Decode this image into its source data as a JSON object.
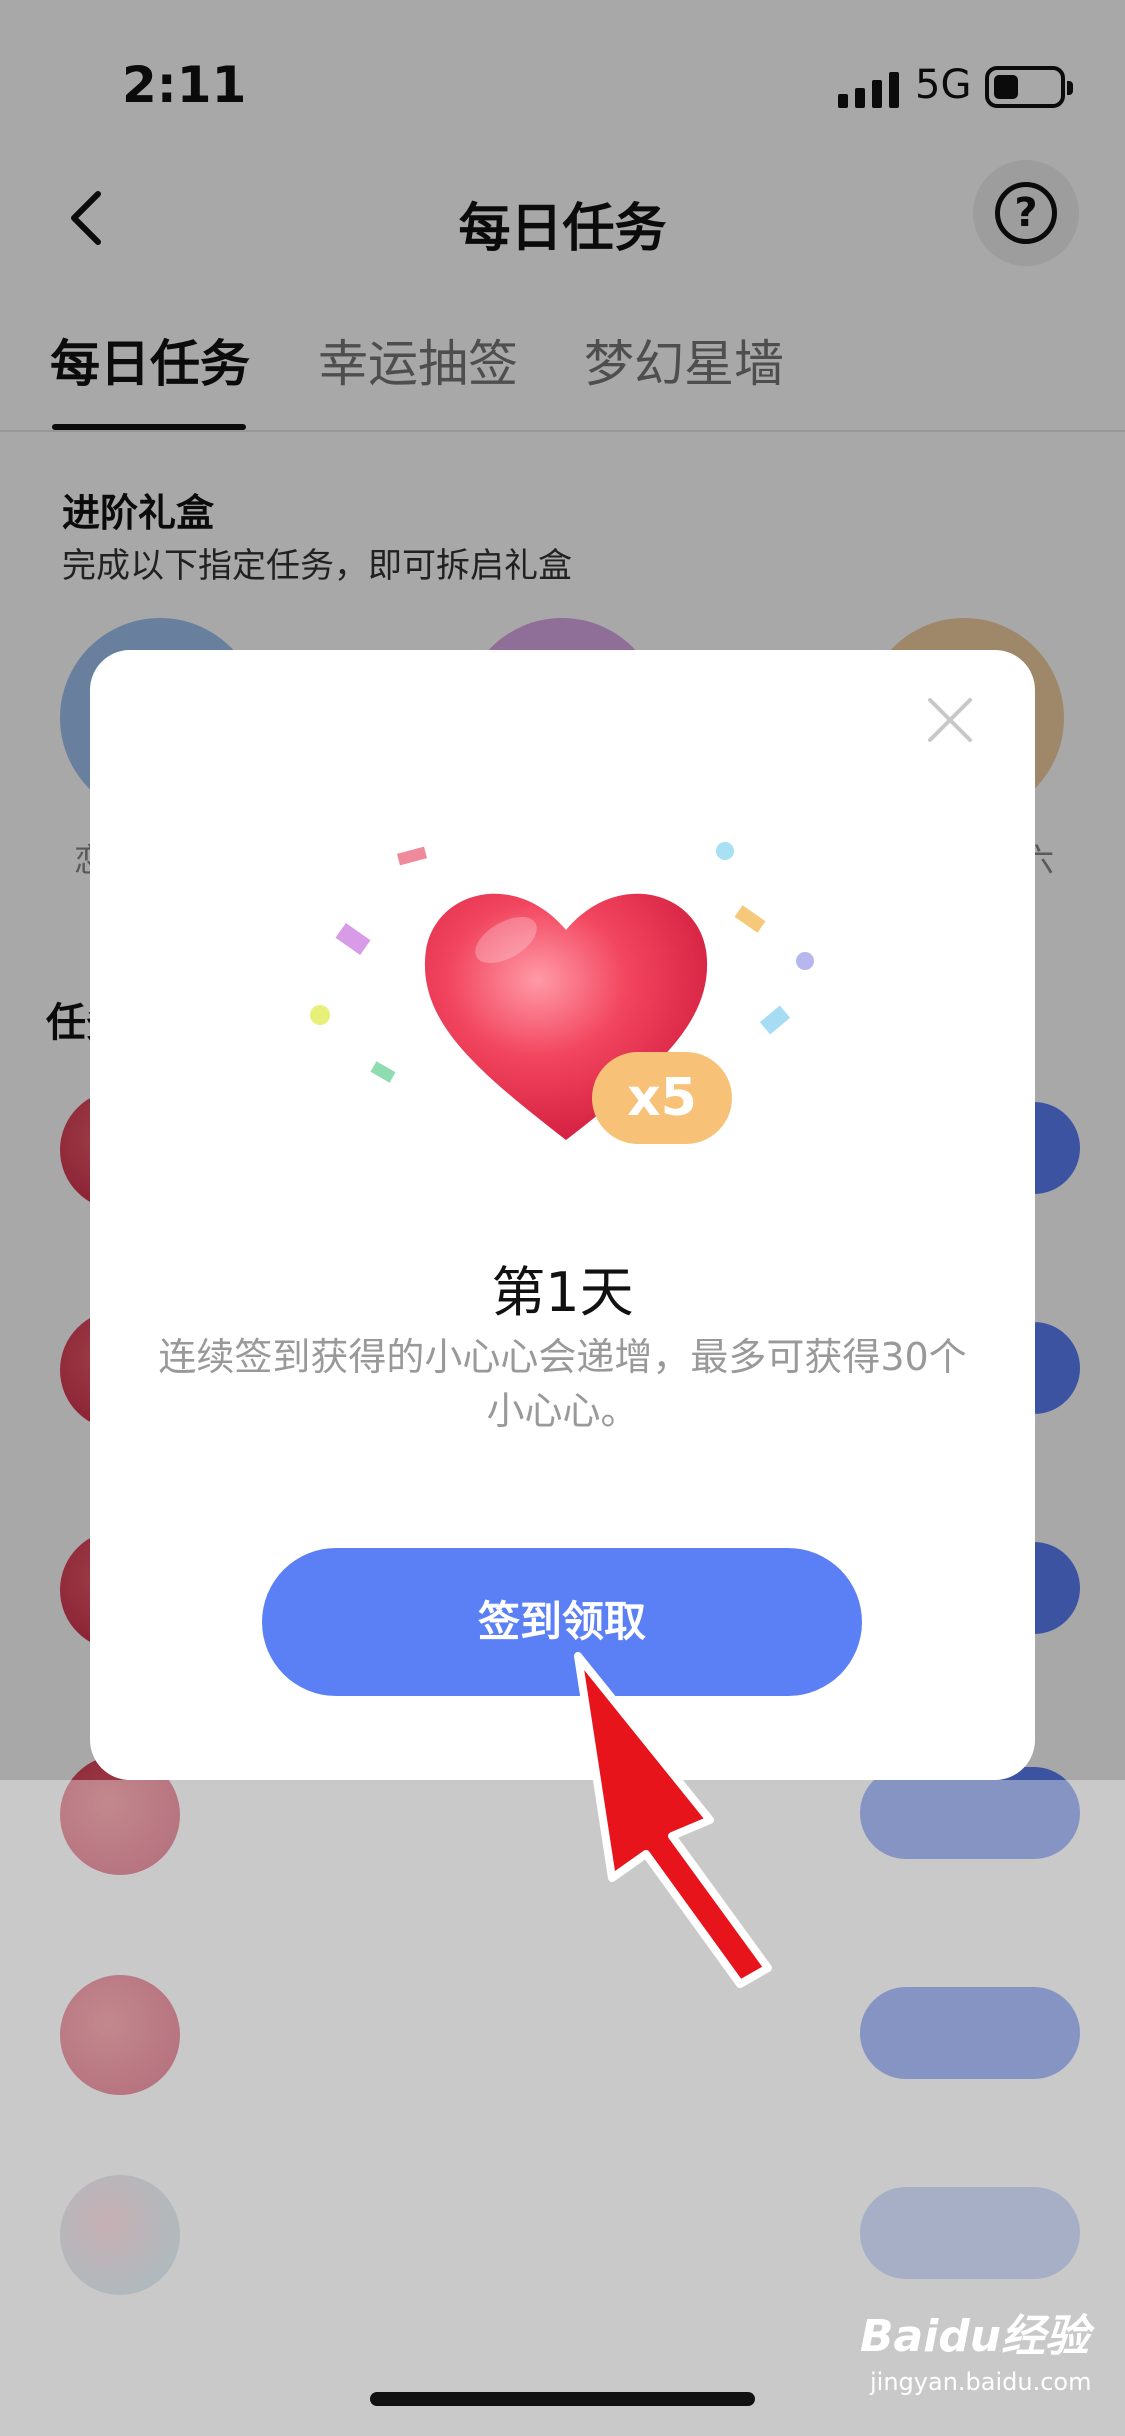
{
  "status_bar": {
    "time": "2:11",
    "network": "5G"
  },
  "nav": {
    "title": "每日任务"
  },
  "tabs": [
    {
      "label": "每日任务",
      "active": true
    },
    {
      "label": "幸运抽签",
      "active": false
    },
    {
      "label": "梦幻星墙",
      "active": false
    }
  ],
  "gift_section": {
    "title": "进阶礼盒",
    "subtitle": "完成以下指定任务，即可拆启礼盒",
    "labels": [
      "恋",
      "六"
    ]
  },
  "tasks": {
    "heading": "任务"
  },
  "modal": {
    "badge": "x5",
    "day_title": "第1天",
    "description": "连续签到获得的小心心会递增，最多可获得30个小心心。",
    "button": "签到领取"
  },
  "watermark": {
    "brand": "Baidu经验",
    "site": "jingyan.baidu.com"
  },
  "colors": {
    "primary_button": "#5b7ff5",
    "badge": "#f7c277",
    "arrow": "#e8141c"
  }
}
